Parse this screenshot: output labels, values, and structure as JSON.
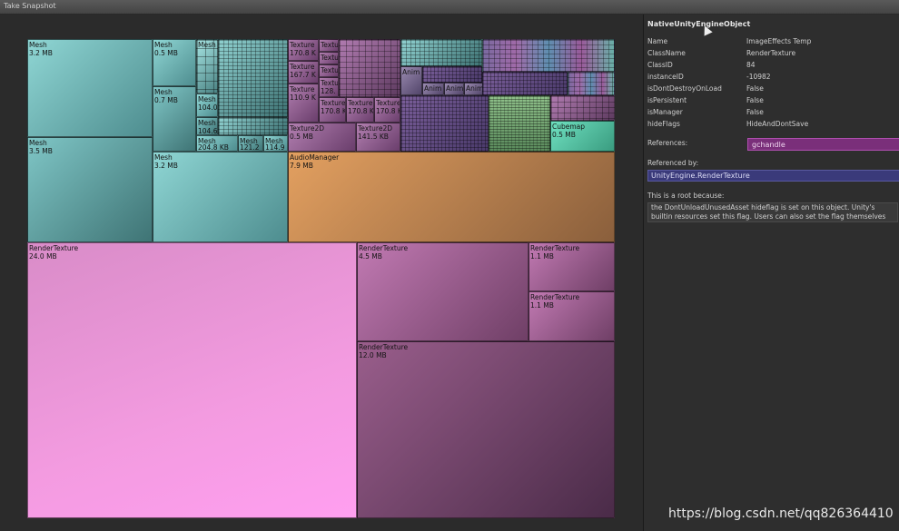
{
  "toolbar": {
    "take_snapshot": "Take Snapshot"
  },
  "treemap": {
    "cells": [
      {
        "id": "mesh-3-2",
        "type": "Mesh",
        "size": "3.2 MB"
      },
      {
        "id": "mesh-3-5",
        "type": "Mesh",
        "size": "3.5 MB"
      },
      {
        "id": "mesh-0-5",
        "type": "Mesh",
        "size": "0.5 MB"
      },
      {
        "id": "mesh-0-7",
        "type": "Mesh",
        "size": "0.7 MB"
      },
      {
        "id": "mesh-3-2b",
        "type": "Mesh",
        "size": "3.2 MB"
      },
      {
        "id": "mesh-a",
        "type": "Mesh",
        "size": ""
      },
      {
        "id": "mesh-104-0",
        "type": "Mesh",
        "size": "104.0"
      },
      {
        "id": "mesh-104-6",
        "type": "Mesh",
        "size": "104.6"
      },
      {
        "id": "mesh-204-8",
        "type": "Mesh",
        "size": "204.8 KB"
      },
      {
        "id": "mesh-121-2",
        "type": "Mesh",
        "size": "121.2"
      },
      {
        "id": "mesh-114-9",
        "type": "Mesh",
        "size": "114.9"
      },
      {
        "id": "tex-170-8",
        "type": "Texture",
        "size": "170.8 K"
      },
      {
        "id": "tex-167-7",
        "type": "Texture",
        "size": "167.7 K"
      },
      {
        "id": "tex-110-9",
        "type": "Texture",
        "size": "110.9 K"
      },
      {
        "id": "tex-a",
        "type": "Texture",
        "size": ""
      },
      {
        "id": "tex-b",
        "type": "Texture",
        "size": ""
      },
      {
        "id": "tex-c",
        "type": "Texture",
        "size": ""
      },
      {
        "id": "tex-128",
        "type": "Texture",
        "size": "128."
      },
      {
        "id": "tex-170-8-b",
        "type": "Texture",
        "size": "170.8 K"
      },
      {
        "id": "tex-170-8-c",
        "type": "Texture",
        "size": "170.8 K"
      },
      {
        "id": "tex-170-8-d",
        "type": "Texture",
        "size": "170.8 K"
      },
      {
        "id": "tex2d-0-5",
        "type": "Texture2D",
        "size": "0.5 MB"
      },
      {
        "id": "tex2d-141-5",
        "type": "Texture2D",
        "size": "141.5 KB"
      },
      {
        "id": "anim-a",
        "type": "Anim",
        "size": ""
      },
      {
        "id": "anim-b",
        "type": "Anim",
        "size": ""
      },
      {
        "id": "anim-c",
        "type": "Anim",
        "size": ""
      },
      {
        "id": "anim-d",
        "type": "Anim",
        "size": ""
      },
      {
        "id": "anim-e",
        "type": "Anim",
        "size": ""
      },
      {
        "id": "cubemap",
        "type": "Cubemap",
        "size": "0.5 MB"
      },
      {
        "id": "audio",
        "type": "AudioManager",
        "size": "7.9 MB"
      },
      {
        "id": "rt-24",
        "type": "RenderTexture",
        "size": "24.0 MB"
      },
      {
        "id": "rt-4-5",
        "type": "RenderTexture",
        "size": "4.5 MB"
      },
      {
        "id": "rt-1-1a",
        "type": "RenderTexture",
        "size": "1.1 MB"
      },
      {
        "id": "rt-1-1b",
        "type": "RenderTexture",
        "size": "1.1 MB"
      },
      {
        "id": "rt-12",
        "type": "RenderTexture",
        "size": "12.0 MB"
      }
    ]
  },
  "inspector": {
    "title": "NativeUnityEngineObject",
    "properties": [
      {
        "key": "Name",
        "value": "ImageEffects Temp"
      },
      {
        "key": "ClassName",
        "value": "RenderTexture"
      },
      {
        "key": "ClassID",
        "value": "84"
      },
      {
        "key": "instanceID",
        "value": "-10982"
      },
      {
        "key": "isDontDestroyOnLoad",
        "value": "False"
      },
      {
        "key": "isPersistent",
        "value": "False"
      },
      {
        "key": "isManager",
        "value": "False"
      },
      {
        "key": "hideFlags",
        "value": "HideAndDontSave"
      }
    ],
    "references_label": "References:",
    "references_value": "gchandle",
    "referenced_by_label": "Referenced by:",
    "referenced_by_value": "UnityEngine.RenderTexture",
    "root_label": "This is a root because:",
    "root_text": "the DontUnloadUnusedAsset hideflag is set on this object. Unity's builtin resources set this flag. Users can also set the flag themselves"
  },
  "watermark": "https://blog.csdn.net/qq826364410",
  "colors": {
    "mesh": "#7fc6c6",
    "texture": "#a06aa0",
    "audio": "#d7955a",
    "render_texture": "#f39be0",
    "references_button": "#7a2f7a",
    "referenced_by_button": "#3a3a7a"
  }
}
